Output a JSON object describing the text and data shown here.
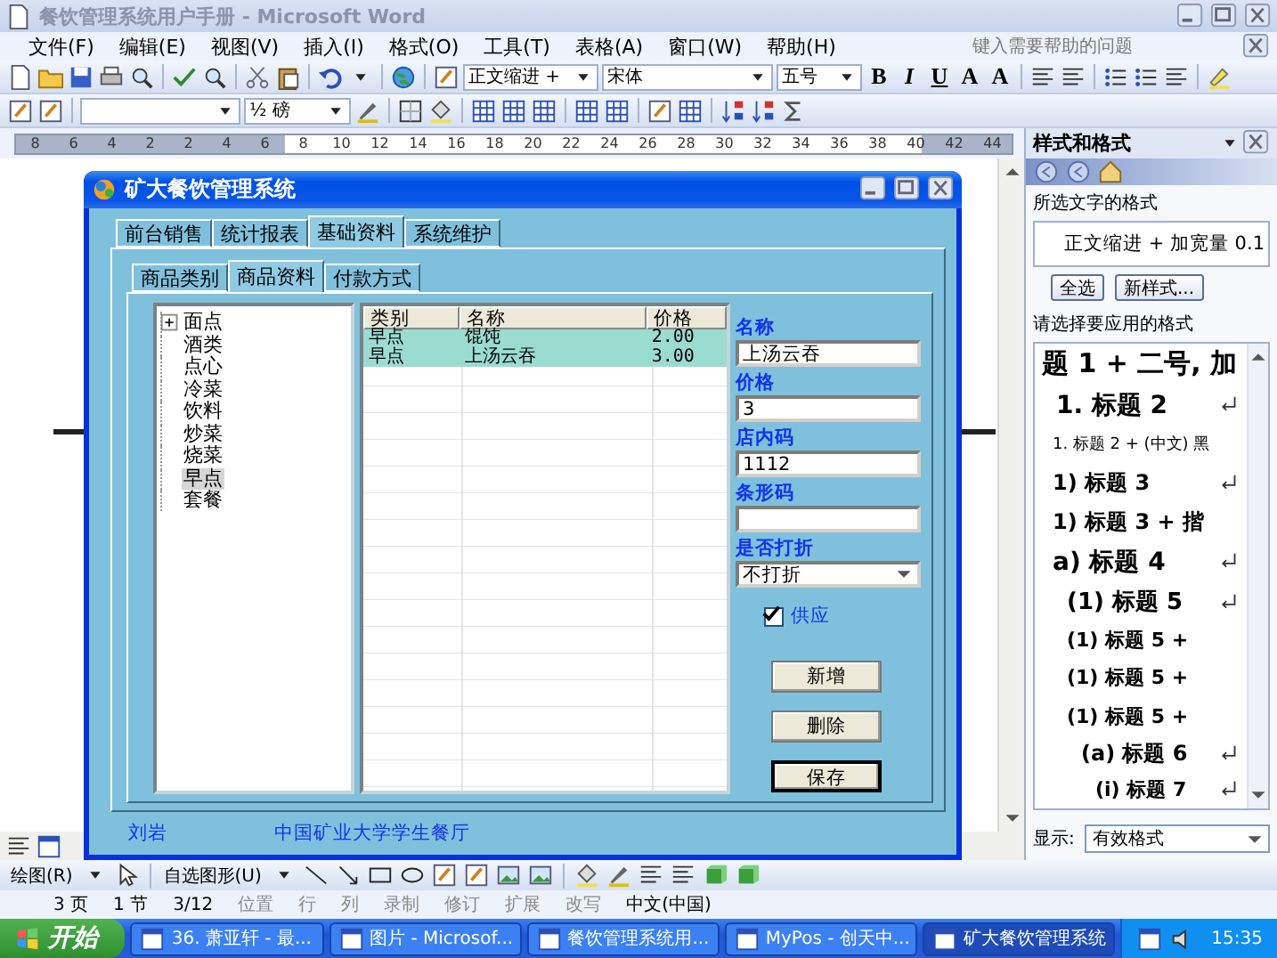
{
  "word": {
    "title": "餐饮管理系统用户手册 - Microsoft Word",
    "menus": [
      "文件(F)",
      "编辑(E)",
      "视图(V)",
      "插入(I)",
      "格式(O)",
      "工具(T)",
      "表格(A)",
      "窗口(W)",
      "帮助(H)"
    ],
    "help_placeholder": "键入需要帮助的问题",
    "style_box": "正文缩进 +",
    "font_box": "宋体",
    "size_box": "五号",
    "format_letters": [
      "B",
      "I",
      "U",
      "A",
      "A"
    ],
    "line_weight": "½ 磅",
    "ruler": [
      "8",
      "6",
      "4",
      "2",
      "2",
      "4",
      "6",
      "8",
      "10",
      "12",
      "14",
      "16",
      "18",
      "20",
      "22",
      "24",
      "26",
      "28",
      "30",
      "32",
      "34",
      "36",
      "38",
      "40",
      "42",
      "44"
    ]
  },
  "app": {
    "title": "矿大餐饮管理系统",
    "tabs": [
      {
        "label": "前台销售",
        "selected": false
      },
      {
        "label": "统计报表",
        "selected": false
      },
      {
        "label": "基础资料",
        "selected": true
      },
      {
        "label": "系统维护",
        "selected": false
      }
    ],
    "subtabs": [
      {
        "label": "商品类别",
        "selected": false
      },
      {
        "label": "商品资料",
        "selected": true
      },
      {
        "label": "付款方式",
        "selected": false
      }
    ],
    "tree": [
      {
        "label": "面点",
        "kind": "branch",
        "selected": false
      },
      {
        "label": "酒类",
        "kind": "leaf",
        "selected": false
      },
      {
        "label": "点心",
        "kind": "leaf",
        "selected": false
      },
      {
        "label": "冷菜",
        "kind": "leaf",
        "selected": false
      },
      {
        "label": "饮料",
        "kind": "leaf",
        "selected": false
      },
      {
        "label": "炒菜",
        "kind": "leaf",
        "selected": false
      },
      {
        "label": "烧菜",
        "kind": "leaf",
        "selected": false
      },
      {
        "label": "早点",
        "kind": "leaf",
        "selected": true
      },
      {
        "label": "套餐",
        "kind": "leaf",
        "selected": false
      }
    ],
    "table": {
      "columns": [
        "类别",
        "名称",
        "价格"
      ],
      "rows": [
        {
          "cells": [
            "早点",
            "馄饨",
            "2.00"
          ],
          "selected": true
        },
        {
          "cells": [
            "早点",
            "上汤云吞",
            "3.00"
          ],
          "selected": true
        }
      ]
    },
    "form": [
      {
        "label": "名称",
        "value": "上汤云吞",
        "kind": "text"
      },
      {
        "label": "价格",
        "value": "3",
        "kind": "text"
      },
      {
        "label": "店内码",
        "value": "1112",
        "kind": "text"
      },
      {
        "label": "条形码",
        "kind": "text"
      },
      {
        "label": "是否打折",
        "value": "不打折",
        "kind": "select"
      }
    ],
    "supply": {
      "label": "供应",
      "checked": true
    },
    "buttons": [
      {
        "label": "新增",
        "default": false
      },
      {
        "label": "删除",
        "default": false
      },
      {
        "label": "保存",
        "default": true
      }
    ],
    "footer": [
      "刘岩",
      "中国矿业大学学生餐厅"
    ]
  },
  "pane": {
    "title": "样式和格式",
    "current_label": "所选文字的格式",
    "current": "正文缩进 + 加宽量 0.1",
    "buttons": [
      "全选",
      "新样式..."
    ],
    "apply_label": "请选择要应用的格式",
    "styles": [
      {
        "text": "题 1 + 二号, 加",
        "kind": "h1",
        "paragraph": false
      },
      {
        "text": "1.  标题 2",
        "kind": "h2",
        "paragraph": true
      },
      {
        "text": "1.  标题 2 + (中文) 黑",
        "kind": "note",
        "paragraph": false
      },
      {
        "text": "1)  标题 3",
        "kind": "h3",
        "paragraph": true
      },
      {
        "text": "1)   标题 3 + 揩",
        "kind": "h3plus",
        "paragraph": false
      },
      {
        "text": "a)  标题 4",
        "kind": "h4",
        "paragraph": true
      },
      {
        "text": "(1)  标题 5",
        "kind": "h5",
        "paragraph": true
      },
      {
        "text": "(1)    标题 5 +",
        "kind": "h5plus",
        "paragraph": false
      },
      {
        "text": "(1)    标题 5 +",
        "kind": "h5plus",
        "paragraph": false
      },
      {
        "text": "(1)    标题 5 +",
        "kind": "h5plus",
        "paragraph": false
      },
      {
        "text": "(a) 标题 6",
        "kind": "h6",
        "paragraph": true
      },
      {
        "text": "(i) 标题 7",
        "kind": "h7",
        "paragraph": true
      }
    ],
    "show_label": "显示:",
    "show_value": "有效格式"
  },
  "drawing_bar": [
    "绘图(R)",
    "自选图形(U)"
  ],
  "status": [
    "3 页",
    "1 节",
    "3/12",
    "位置",
    "行",
    "列",
    "录制",
    "修订",
    "扩展",
    "改写",
    "中文(中国)"
  ],
  "taskbar": {
    "start": "开始",
    "tasks": [
      {
        "label": "36. 萧亚轩 - 最...",
        "selected": false
      },
      {
        "label": "图片 - Microsof...",
        "selected": false
      },
      {
        "label": "餐饮管理系统用...",
        "selected": false
      },
      {
        "label": "MyPos - 创天中...",
        "selected": false
      },
      {
        "label": "矿大餐饮管理系统",
        "selected": true
      }
    ],
    "clock": "15:35"
  }
}
